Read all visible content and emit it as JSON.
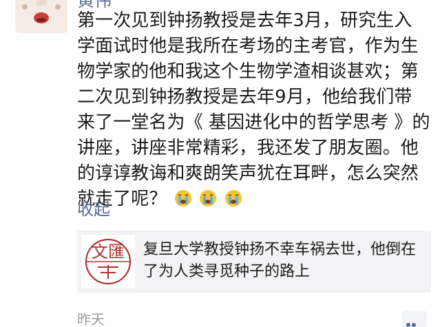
{
  "post": {
    "username": "黄伟",
    "lines": [
      "第一次见到钟扬教授是去年3月，研究生入",
      "学面试时他是我所在考场的主考官，作为生",
      "物学家的他和我这个生物学渣相谈甚欢；第",
      "二次见到钟扬教授是去年9月，他给我们带",
      "来了一堂名为《 基因进化中的哲学思考 》的",
      "讲座，讲座非常精彩，我还发了朋友圈。他",
      "的谆谆教诲和爽朗笑声犹在耳畔，怎么突然",
      "就走了呢？"
    ],
    "emojis": [
      "crying-emoji",
      "crying-emoji",
      "crying-emoji"
    ],
    "collapse_label": "收起",
    "timestamp": "昨天"
  },
  "shared_article": {
    "title": "复旦大学教授钟扬不幸车祸去世，他倒在了为人类寻觅种子的路上",
    "thumbnail_icon": "university-seal-logo",
    "logo_text": "文匯"
  },
  "colors": {
    "link": "#576b95",
    "text": "#1b1b1b",
    "muted": "#9b9b9b",
    "card_bg": "#f3f3f5",
    "logo_red": "#b4302f"
  }
}
